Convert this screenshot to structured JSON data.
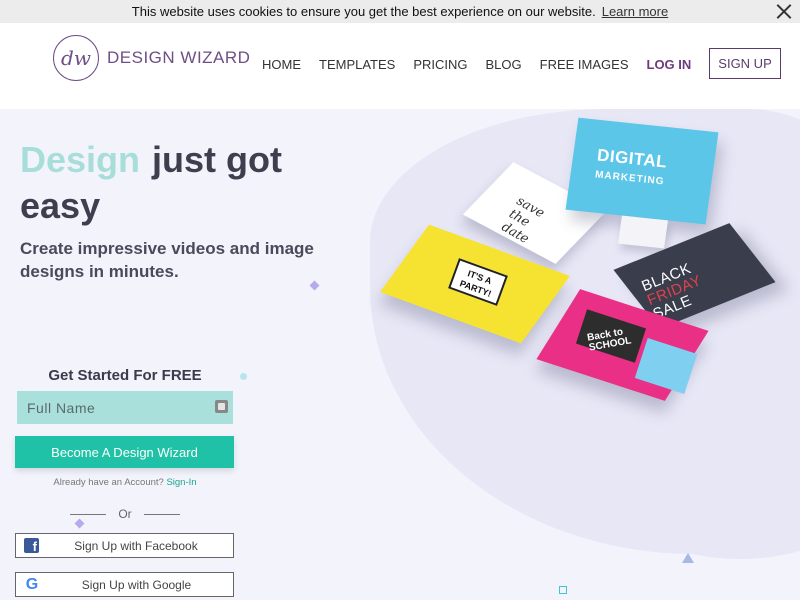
{
  "cookie": {
    "message": "This website uses cookies to ensure you get the best experience on our website.",
    "learn_more": "Learn more"
  },
  "brand": {
    "mark": "dw",
    "name": "DESIGN WIZARD"
  },
  "nav": {
    "items": [
      "HOME",
      "TEMPLATES",
      "PRICING",
      "BLOG",
      "FREE IMAGES"
    ],
    "login": "LOG IN",
    "signup": "SIGN UP"
  },
  "hero": {
    "title_accent": "Design",
    "title_rest": "just got easy",
    "subtitle": "Create impressive videos and image designs in minutes."
  },
  "form": {
    "title": "Get Started For FREE",
    "name_placeholder": "Full Name",
    "cta": "Become A Design Wizard",
    "already_text": "Already have an Account?",
    "signin_link": "Sign-In",
    "or": "Or",
    "facebook": "Sign Up with Facebook",
    "google": "Sign Up with Google"
  },
  "mockups": {
    "monitor_line1": "DIGITAL",
    "monitor_line2": "MARKETING",
    "card_white": "save the date",
    "party_line1": "IT'S A",
    "party_line2": "PARTY!",
    "sale_line1": "BLACK",
    "sale_line2": "FRIDAY",
    "sale_line3": "SALE",
    "school_line1": "Back to",
    "school_line2": "SCHOOL"
  },
  "colors": {
    "accent_teal": "#1fc2a6",
    "title_accent": "#a8ded9",
    "brand_purple": "#6f4e86",
    "hero_bg": "#f2f3fb"
  },
  "icons": {
    "close": "close-icon",
    "facebook": "facebook-icon",
    "google": "google-icon",
    "field": "id-card-icon"
  }
}
